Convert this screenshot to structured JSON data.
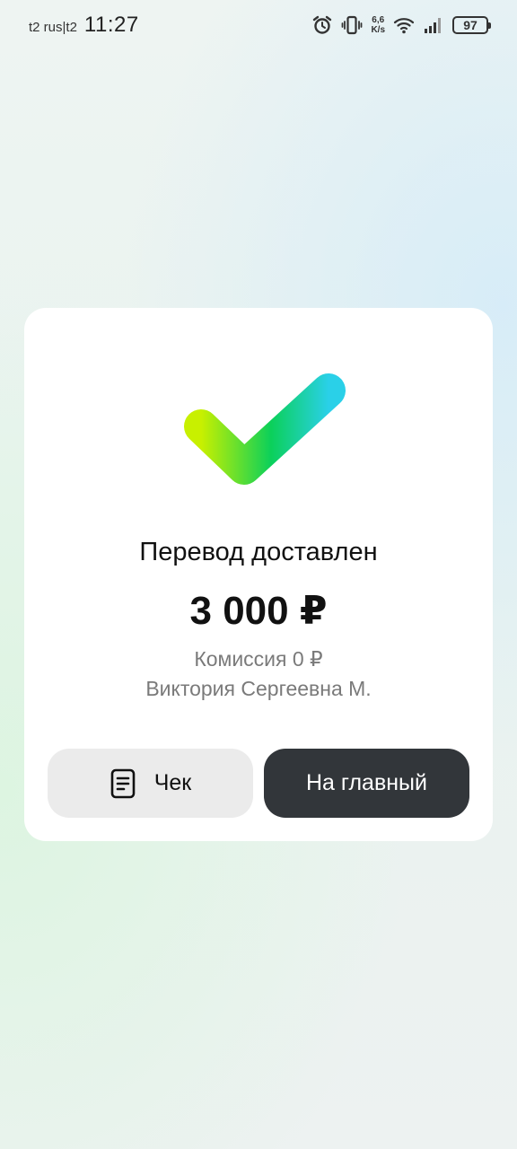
{
  "status_bar": {
    "carrier": "t2 rus|t2",
    "time": "11:27",
    "net_speed_value": "6,6",
    "net_speed_unit": "K/s",
    "battery": "97",
    "icons": [
      "alarm-icon",
      "vibrate-icon",
      "wifi-icon",
      "signal-icon"
    ]
  },
  "result": {
    "icon": "success-checkmark-icon",
    "title": "Перевод доставлен",
    "amount": "3 000 ₽",
    "fee": "Комиссия 0 ₽",
    "recipient": "Виктория Сергеевна М."
  },
  "actions": {
    "receipt_label": "Чек",
    "receipt_icon": "receipt-icon",
    "home_label": "На главный"
  },
  "colors": {
    "check_gradient_start": "#c8f000",
    "check_gradient_mid": "#0bd05a",
    "check_gradient_end": "#2ad0e8",
    "primary_button": "#32363a",
    "secondary_button": "#ebebeb"
  }
}
